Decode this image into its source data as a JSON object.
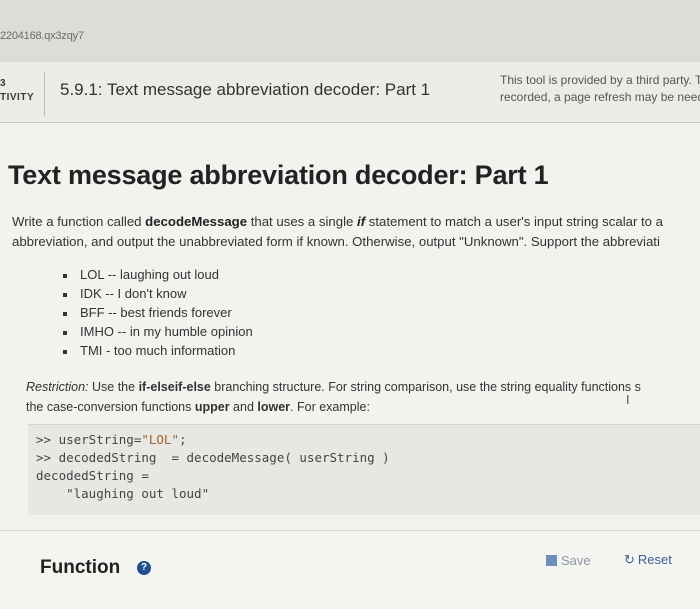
{
  "browser": {
    "url_fragment": "2204168.qx3zqy7"
  },
  "activity_bar": {
    "activity_number": "3",
    "activity_label": "TIVITY",
    "title": "5.9.1: Text message abbreviation decoder: Part 1",
    "third_party_line1": "This tool is provided by a third party. T",
    "third_party_line2": "recorded, a page refresh may be need"
  },
  "content": {
    "title": "Text message abbreviation decoder: Part 1",
    "desc_p1": "Write a function called ",
    "desc_fn": "decodeMessage",
    "desc_p2": " that uses a single ",
    "desc_if": "if",
    "desc_p3": " statement to match a user's input string scalar to a",
    "desc_line2": "abbreviation, and output the unabbreviated form if known. Otherwise, output \"Unknown\". Support the abbreviati",
    "abbreviations": [
      "LOL -- laughing out loud",
      "IDK -- I don't know",
      "BFF -- best friends forever",
      "IMHO -- in my humble opinion",
      "TMI - too much information"
    ],
    "restriction_label": "Restriction:",
    "restriction_p1": " Use the ",
    "restriction_struct": "if-elseif-else",
    "restriction_p2": " branching structure.  For string comparison, use the string equality functions s",
    "restriction_line2_p1": "the case-conversion functions ",
    "restriction_upper": "upper",
    "restriction_and": " and ",
    "restriction_lower": "lower",
    "restriction_line2_p2": ". For example:"
  },
  "code_example": {
    "line1_prefix": ">> userString=",
    "line1_str": "\"LOL\"",
    "line1_suffix": ";",
    "line2": ">> decodedString  = decodeMessage( userString )",
    "line3": "decodedString =",
    "line4": "    \"laughing out loud\""
  },
  "function_bar": {
    "title": "Function",
    "help_glyph": "?",
    "save_label": "Save",
    "reset_label": "Reset",
    "reset_glyph": "↻"
  },
  "colors": {
    "accent_blue": "#1f4f8c",
    "code_string": "#a0642a"
  }
}
